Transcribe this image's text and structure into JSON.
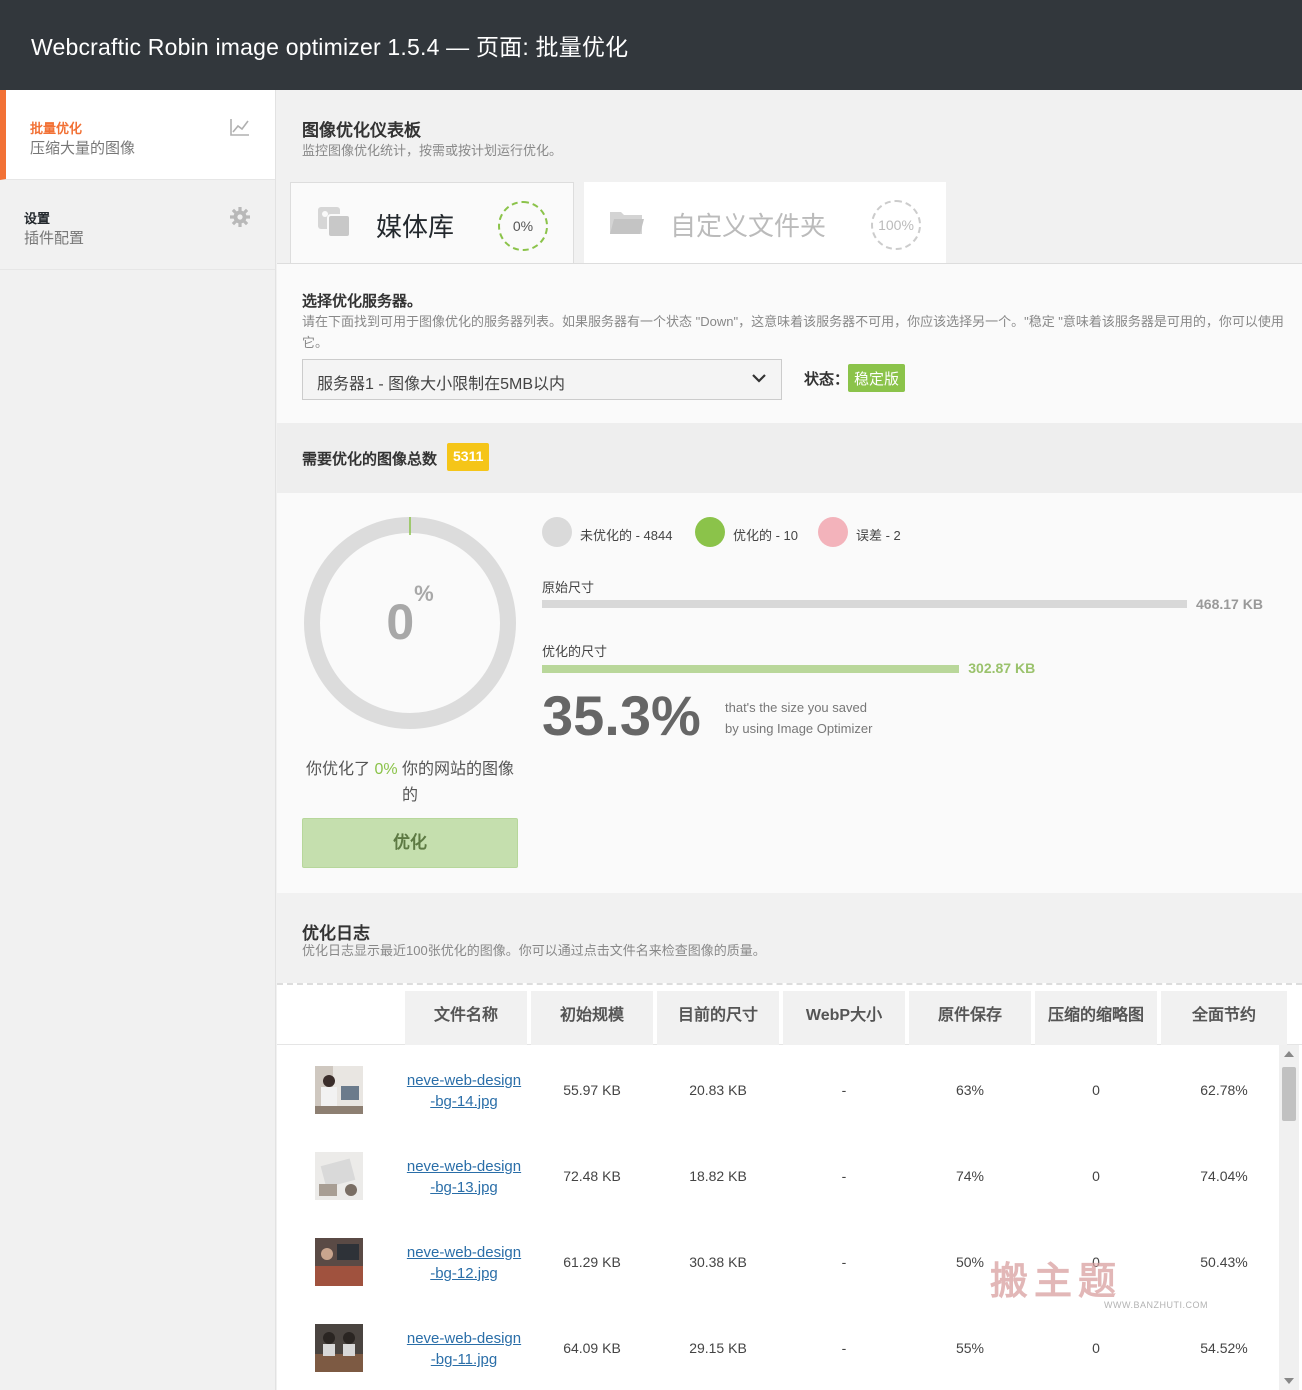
{
  "header": {
    "title": "Webcraftic Robin image optimizer 1.5.4 — 页面: 批量优化"
  },
  "sidebar": {
    "items": [
      {
        "label": "批量优化",
        "desc": "压缩大量的图像",
        "icon": "chart-line-icon",
        "active": true
      },
      {
        "label": "设置",
        "desc": "插件配置",
        "icon": "gear-icon",
        "active": false
      }
    ]
  },
  "dashboard": {
    "title": "图像优化仪表板",
    "subtitle": "监控图像优化统计，按需或按计划运行优化。"
  },
  "tabs": [
    {
      "label": "媒体库",
      "percent": "0%",
      "icon": "images-icon"
    },
    {
      "label": "自定义文件夹",
      "percent": "100%",
      "icon": "folder-icon"
    }
  ],
  "server": {
    "title": "选择优化服务器。",
    "description": "请在下面找到可用于图像优化的服务器列表。如果服务器有一个状态 \"Down\"，这意味着该服务器不可用，你应该选择另一个。\"稳定 \"意味着该服务器是可用的，你可以使用它。",
    "selected": "服务器1 - 图像大小限制在5MB以内",
    "status_label": "状态：",
    "status_value": "稳定版",
    "status_color": "#8bc34a"
  },
  "totals": {
    "label": "需要优化的图像总数",
    "count": "5311"
  },
  "progress": {
    "percent_value": "0",
    "percent_sign": "%",
    "optimized_fraction": 0.0,
    "text_before": "你优化了",
    "text_pct": "0%",
    "text_after": "你的网站的图像的",
    "button_label": "优化"
  },
  "legend": [
    {
      "label": "未优化的 - 4844",
      "color": "#dadada"
    },
    {
      "label": "优化的 - 10",
      "color": "#8bc34a"
    },
    {
      "label": "误差 - 2",
      "color": "#f3b3bb"
    }
  ],
  "sizes": {
    "original_label": "原始尺寸",
    "original_value": "468.17 KB",
    "original_kb": 468.17,
    "optimized_label": "优化的尺寸",
    "optimized_value": "302.87 KB",
    "optimized_kb": 302.87,
    "saving_percent": "35.3%",
    "saving_note_line1": "that's the size you saved",
    "saving_note_line2": "by using Image Optimizer"
  },
  "log": {
    "title": "优化日志",
    "subtitle": "优化日志显示最近100张优化的图像。你可以通过点击文件名来检查图像的质量。",
    "columns": [
      "文件名称",
      "初始规模",
      "目前的尺寸",
      "WebP大小",
      "原件保存",
      "压缩的缩略图",
      "全面节约"
    ],
    "rows": [
      {
        "filename": "neve-web-design-bg-14.jpg",
        "initial": "55.97 KB",
        "current": "20.83 KB",
        "webp": "-",
        "saved": "63%",
        "thumbs": "0",
        "total": "62.78%"
      },
      {
        "filename": "neve-web-design-bg-13.jpg",
        "initial": "72.48 KB",
        "current": "18.82 KB",
        "webp": "-",
        "saved": "74%",
        "thumbs": "0",
        "total": "74.04%"
      },
      {
        "filename": "neve-web-design-bg-12.jpg",
        "initial": "61.29 KB",
        "current": "30.38 KB",
        "webp": "-",
        "saved": "50%",
        "thumbs": "0",
        "total": "50.43%"
      },
      {
        "filename": "neve-web-design-bg-11.jpg",
        "initial": "64.09 KB",
        "current": "29.15 KB",
        "webp": "-",
        "saved": "55%",
        "thumbs": "0",
        "total": "54.52%"
      }
    ]
  },
  "watermark": {
    "main": "搬主题",
    "sub": "WWW.BANZHUTI.COM"
  }
}
